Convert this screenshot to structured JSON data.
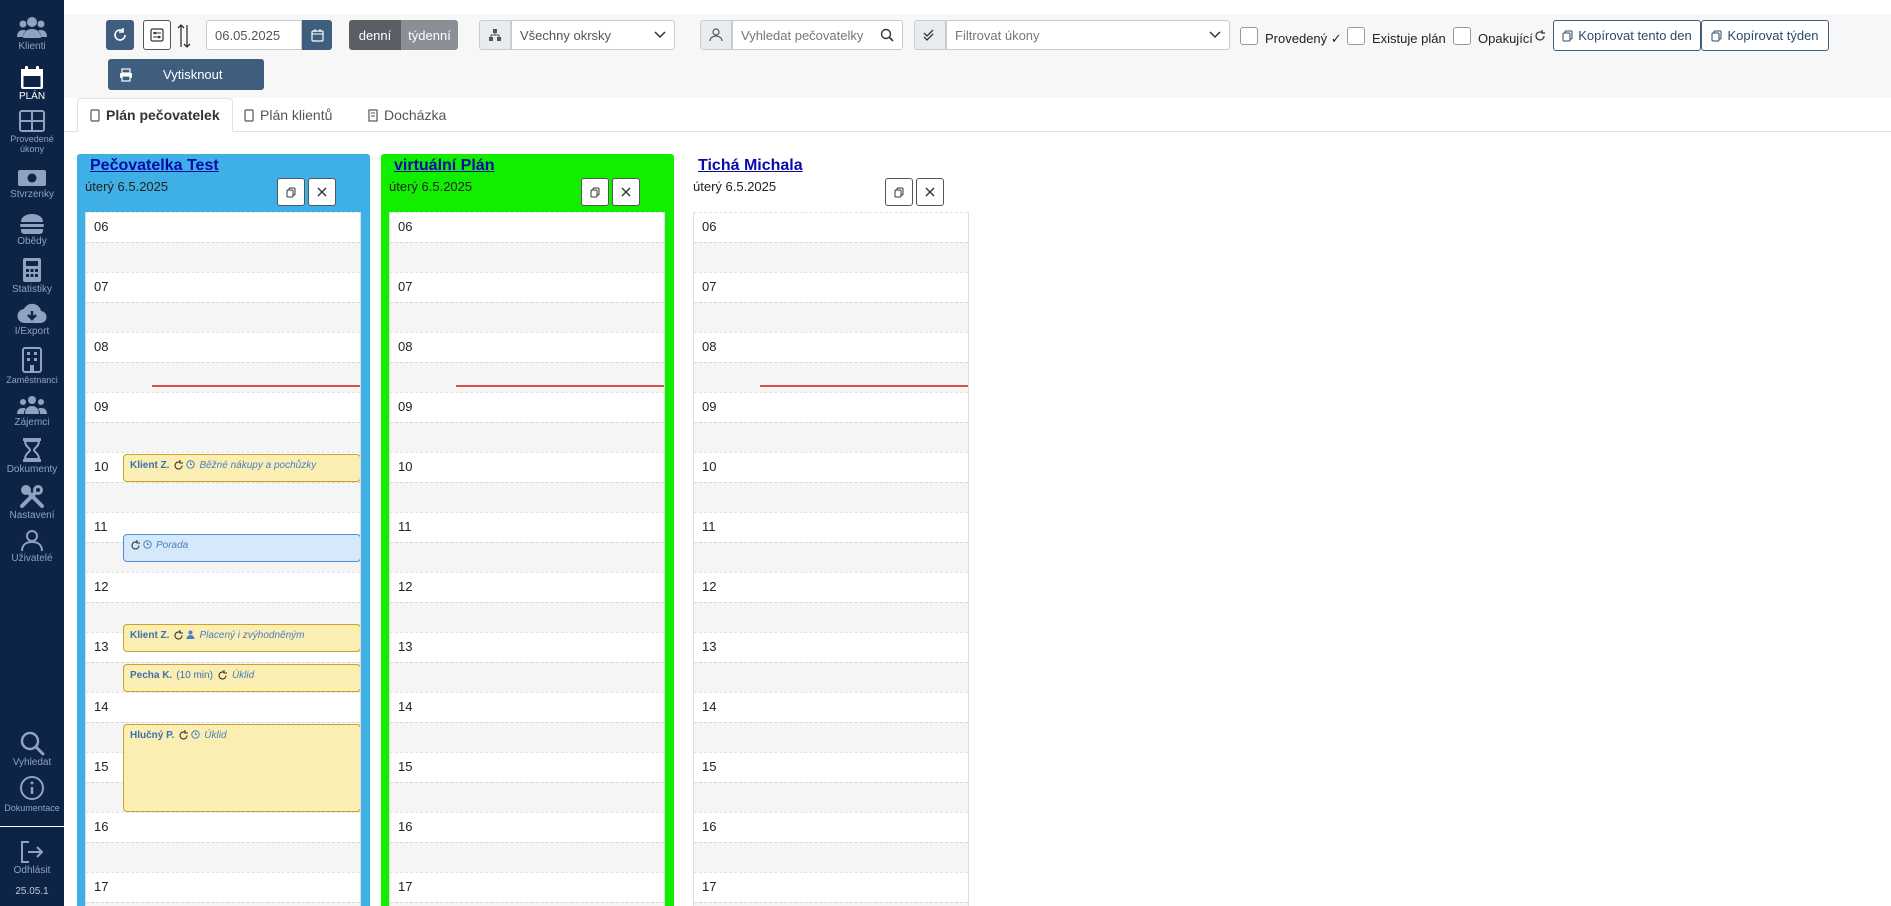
{
  "sidebar": {
    "items": [
      {
        "label": "Klienti",
        "icon": "users-icon",
        "active": false
      },
      {
        "label": "PLÁN",
        "icon": "calendar-icon",
        "active": true
      },
      {
        "label": "Provedené úkony",
        "icon": "grid-icon",
        "active": false
      },
      {
        "label": "Stvrzenky",
        "icon": "money-icon",
        "active": false
      },
      {
        "label": "Obědy",
        "icon": "burger-icon",
        "active": false
      },
      {
        "label": "Statistiky",
        "icon": "calculator-icon",
        "active": false
      },
      {
        "label": "I/Export",
        "icon": "cloud-download-icon",
        "active": false
      },
      {
        "label": "Zaměstnanci",
        "icon": "building-icon",
        "active": false
      },
      {
        "label": "Zájemci",
        "icon": "group-icon",
        "active": false
      },
      {
        "label": "Dokumenty",
        "icon": "hourglass-icon",
        "active": false
      },
      {
        "label": "Nastavení",
        "icon": "tools-icon",
        "active": false
      },
      {
        "label": "Uživatelé",
        "icon": "user-icon",
        "active": false
      }
    ],
    "bottom": [
      {
        "label": "Vyhledat",
        "icon": "search-icon"
      },
      {
        "label": "Dokumentace",
        "icon": "info-icon"
      },
      {
        "label": "Odhlásit",
        "icon": "logout-icon"
      }
    ],
    "version": "25.05.1"
  },
  "toolbar": {
    "date_value": "06.05.2025",
    "view_daily": "denní",
    "view_weekly": "týdenní",
    "district_select": "Všechny okrsky",
    "search_placeholder": "Vyhledat pečovatelky",
    "filter_placeholder": "Filtrovat úkony",
    "chk_provedeny": "Provedený ✓",
    "chk_plan": "Existuje plán",
    "chk_opakujici": "Opakující",
    "copy_day": "Kopírovat tento den",
    "copy_week": "Kopírovat týden",
    "print": "Vytisknout"
  },
  "tabs": [
    {
      "label": "Plán pečovatelek",
      "active": true
    },
    {
      "label": "Plán klientů",
      "active": false
    },
    {
      "label": "Docházka",
      "active": false
    }
  ],
  "hours": [
    "06",
    "07",
    "08",
    "09",
    "10",
    "11",
    "12",
    "13",
    "14",
    "15",
    "16",
    "17"
  ],
  "columns": [
    {
      "name": "Pečovatelka Test",
      "date": "úterý 6.5.2025",
      "color": "#3eb0e6",
      "events": [
        {
          "client": "Klient Z.",
          "extra": "",
          "service": "Běžné nákupy a pochůzky",
          "icon": "clock-icon",
          "color": "yellow"
        },
        {
          "client": "",
          "extra": "",
          "service": "Porada",
          "icon": "clock-icon",
          "color": "blue"
        },
        {
          "client": "Klient Z.",
          "extra": "",
          "service": "Placený i zvýhodněným",
          "icon": "person-icon",
          "color": "yellow"
        },
        {
          "client": "Pecha K.",
          "extra": "(10 min)",
          "service": "Úklid",
          "icon": "",
          "color": "yellow"
        },
        {
          "client": "Hlučný P.",
          "extra": "",
          "service": "Úklid",
          "icon": "clock-icon",
          "color": "yellow"
        }
      ]
    },
    {
      "name": "virtuální Plán",
      "date": "úterý 6.5.2025",
      "color": "#11ee00",
      "events": []
    },
    {
      "name": "Tichá Michala",
      "date": "úterý 6.5.2025",
      "color": "#ffffff",
      "events": []
    }
  ]
}
